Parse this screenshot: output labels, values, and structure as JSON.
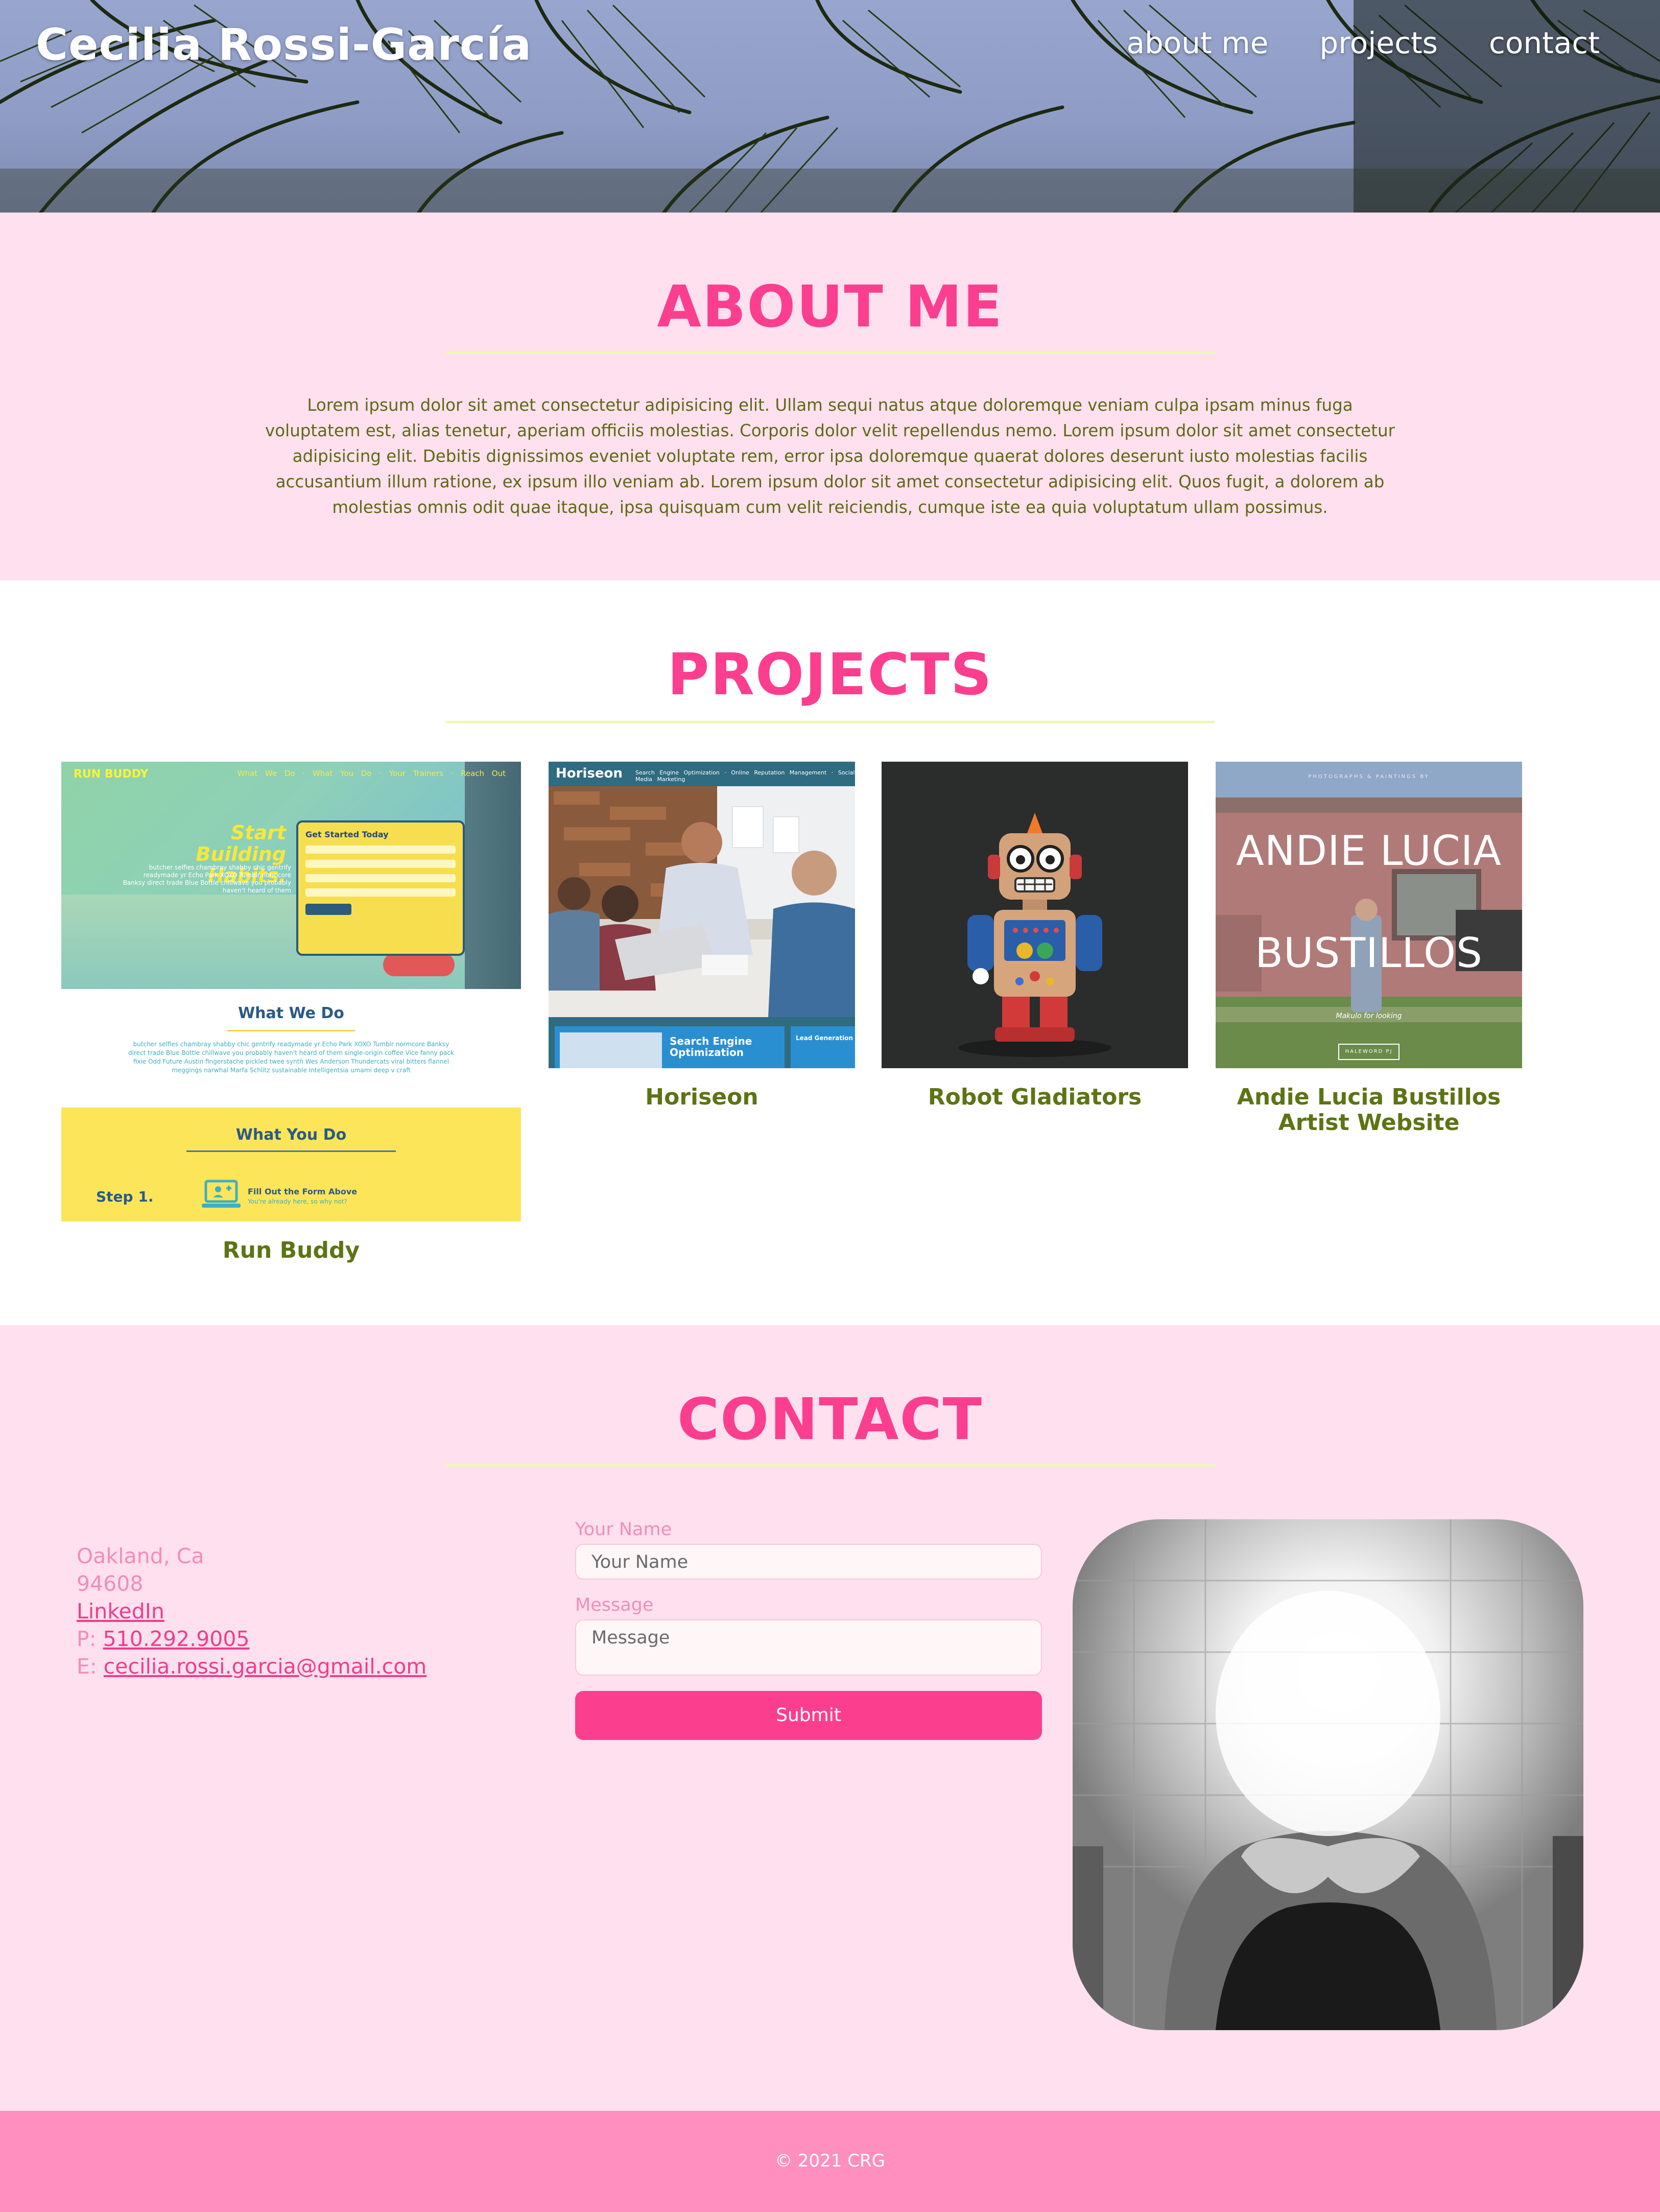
{
  "header": {
    "title": "Cecilia Rossi-García",
    "nav": [
      "about me",
      "projects",
      "contact"
    ]
  },
  "about": {
    "title": "ABOUT ME",
    "text": "Lorem ipsum dolor sit amet consectetur adipisicing elit. Ullam sequi natus atque doloremque veniam culpa ipsam minus fuga voluptatem est, alias tenetur, aperiam officiis molestias. Corporis dolor velit repellendus nemo. Lorem ipsum dolor sit amet consectetur adipisicing elit. Debitis dignissimos eveniet voluptate rem, error ipsa doloremque quaerat dolores deserunt iusto molestias facilis accusantium illum ratione, ex ipsum illo veniam ab. Lorem ipsum dolor sit amet consectetur adipisicing elit. Quos fugit, a dolorem ab molestias omnis odit quae itaque, ipsa quisquam cum velit reiciendis, cumque iste ea quia voluptatum ullam possimus."
  },
  "projects": {
    "title": "PROJECTS",
    "items": [
      {
        "caption": "Run Buddy",
        "shot": {
          "logo": "RUN BUDDY",
          "nav": "What We Do · What You Do · Your Trainers · Reach Out",
          "headline": "Start Building Habits.",
          "copy": "butcher selfies chambray shabby chic gentrify readymade yr Echo Park XOXO Tumblr normcore Banksy direct trade Blue Bottle chillwave you probably haven't heard of them",
          "form_title": "Get Started Today",
          "section1": "What We Do",
          "section1_text": "butcher selfies chambray shabby chic gentrify readymade yr Echo Park XOXO Tumblr normcore Banksy direct trade Blue Bottle chillwave you probably haven't heard of them single-origin coffee Vice fanny pack fixie Odd Future Austin fingerstache pickled twee synth Wes Anderson Thundercats viral bitters flannel meggings narwhal Marfa Schlitz sustainable Intelligentsia umami deep v craft",
          "section2": "What You Do",
          "step": "Step 1.",
          "step_title": "Fill Out the Form Above",
          "step_sub": "You're already here, so why not?"
        }
      },
      {
        "caption": "Horiseon",
        "shot": {
          "logo": "Horiseon",
          "nav": "Search Engine Optimization · Online Reputation Management · Social Media Marketing",
          "card1": "Search Engine Optimization",
          "card2": "Lead Generation"
        }
      },
      {
        "caption": "Robot Gladiators"
      },
      {
        "caption": "Andie Lucia Bustillos Artist Website",
        "shot": {
          "tagline": "PHOTOGRAPHS & PAINTINGS BY",
          "name_line1": "ANDIE LUCIA",
          "name_line2": "BUSTILLOS",
          "signature": "Makulo for looking",
          "button": "HALEWORD PJ"
        }
      }
    ]
  },
  "contact": {
    "title": "CONTACT",
    "city": "Oakland, Ca",
    "zip": "94608",
    "linkedin": "LinkedIn",
    "phone_prefix": "P:",
    "phone": "510.292.9005",
    "email_prefix": "E:",
    "email": "cecilia.rossi.garcia@gmail.com",
    "form": {
      "name_label": "Your Name",
      "name_placeholder": "Your Name",
      "message_label": "Message",
      "message_placeholder": "Message",
      "submit": "Submit"
    }
  },
  "footer": {
    "copyright": "© 2021 CRG"
  },
  "colors": {
    "accent_pink": "#fb3f8e",
    "section_bg": "#ffe0ee",
    "footer_bg": "#ff8fbf",
    "text_olive": "#5d6a14",
    "rule_yellow": "#f0f7b4"
  }
}
